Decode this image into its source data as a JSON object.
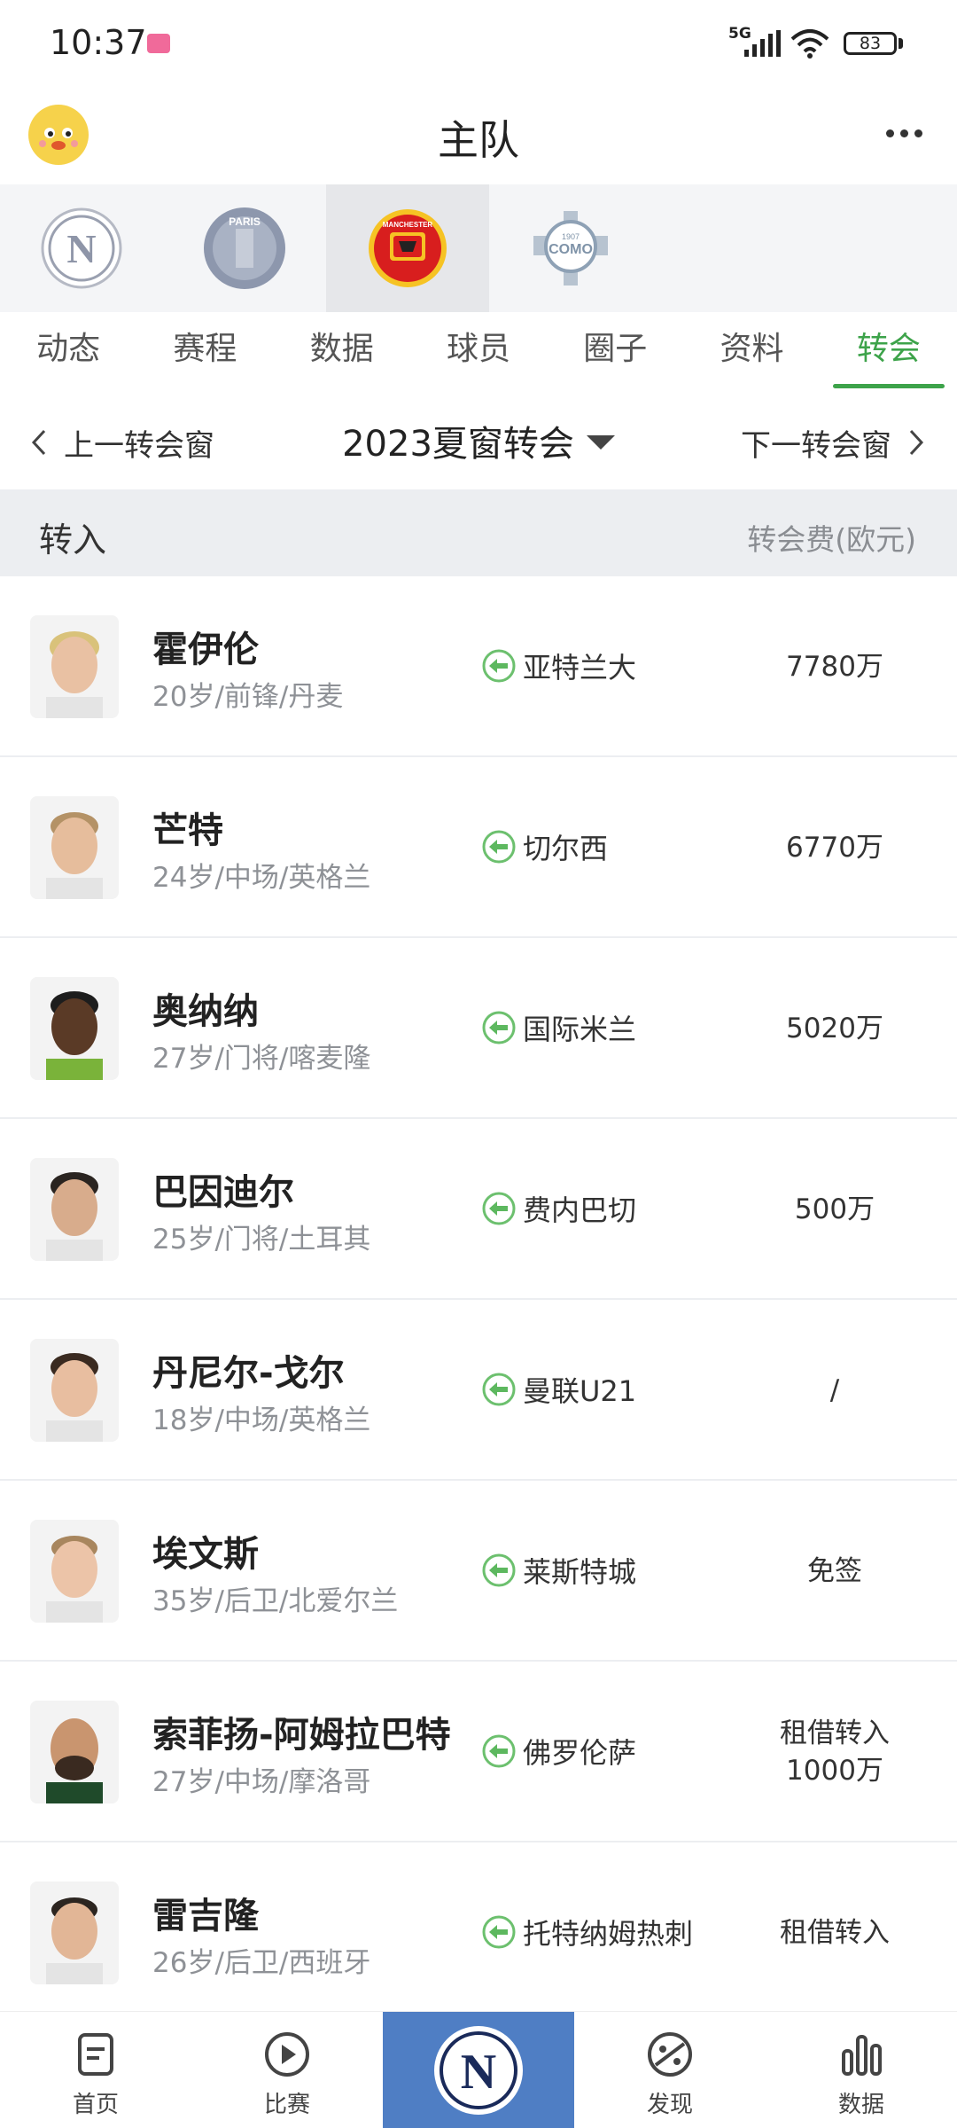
{
  "status_bar": {
    "time": "10:37",
    "network": "5G",
    "battery": "83"
  },
  "header": {
    "title": "主队"
  },
  "teams": [
    {
      "name": "napoli-logo",
      "selected": false
    },
    {
      "name": "psg-logo",
      "selected": false
    },
    {
      "name": "manchester-united-logo",
      "selected": true
    },
    {
      "name": "como-logo",
      "selected": false
    }
  ],
  "team_logo_text": {
    "psg": "PARIS",
    "mu": "MANCHESTER",
    "como": "COMO",
    "como_year": "1907",
    "napoli": "N"
  },
  "tabs": [
    {
      "label": "动态",
      "active": false
    },
    {
      "label": "赛程",
      "active": false
    },
    {
      "label": "数据",
      "active": false
    },
    {
      "label": "球员",
      "active": false
    },
    {
      "label": "圈子",
      "active": false
    },
    {
      "label": "资料",
      "active": false
    },
    {
      "label": "转会",
      "active": true
    }
  ],
  "window_nav": {
    "prev": "上一转会窗",
    "title": "2023夏窗转会",
    "next": "下一转会窗"
  },
  "section": {
    "title": "转入",
    "fee_header": "转会费(欧元)"
  },
  "transfers": [
    {
      "name": "霍伊伦",
      "meta": "20岁/前锋/丹麦",
      "from": "亚特兰大",
      "fee": "7780万",
      "fee2": ""
    },
    {
      "name": "芒特",
      "meta": "24岁/中场/英格兰",
      "from": "切尔西",
      "fee": "6770万",
      "fee2": ""
    },
    {
      "name": "奥纳纳",
      "meta": "27岁/门将/喀麦隆",
      "from": "国际米兰",
      "fee": "5020万",
      "fee2": ""
    },
    {
      "name": "巴因迪尔",
      "meta": "25岁/门将/土耳其",
      "from": "费内巴切",
      "fee": "500万",
      "fee2": ""
    },
    {
      "name": "丹尼尔-戈尔",
      "meta": "18岁/中场/英格兰",
      "from": "曼联U21",
      "fee": "/",
      "fee2": ""
    },
    {
      "name": "埃文斯",
      "meta": "35岁/后卫/北爱尔兰",
      "from": "莱斯特城",
      "fee": "免签",
      "fee2": ""
    },
    {
      "name": "索菲扬-阿姆拉巴特",
      "meta": "27岁/中场/摩洛哥",
      "from": "佛罗伦萨",
      "fee": "租借转入",
      "fee2": "1000万"
    },
    {
      "name": "雷吉隆",
      "meta": "26岁/后卫/西班牙",
      "from": "托特纳姆热刺",
      "fee": "租借转入",
      "fee2": ""
    }
  ],
  "bottom_nav": [
    {
      "label": "首页",
      "icon": "home-doc-icon"
    },
    {
      "label": "比赛",
      "icon": "play-icon"
    },
    {
      "label": "",
      "icon": "napoli-logo"
    },
    {
      "label": "发现",
      "icon": "discover-icon"
    },
    {
      "label": "数据",
      "icon": "stats-icon"
    }
  ],
  "colors": {
    "accent": "#3da34a",
    "center_nav": "#4f7ec4",
    "section_bg": "#eceef1"
  }
}
